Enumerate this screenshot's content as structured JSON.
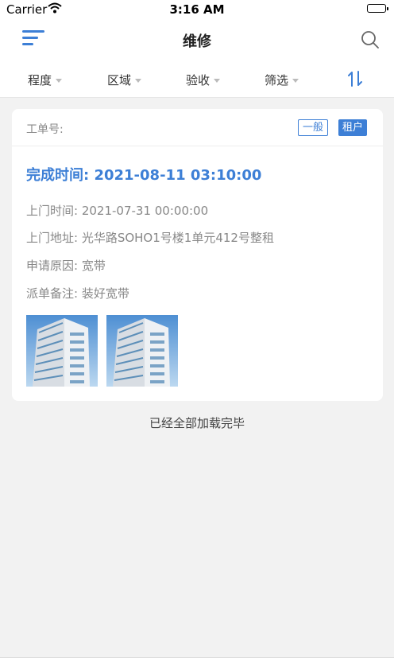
{
  "status_bar": {
    "carrier": "Carrier",
    "time": "3:16 AM"
  },
  "nav": {
    "title": "维修",
    "menu_icon": "menu-icon",
    "search_icon": "search-icon"
  },
  "filters": [
    {
      "label": "程度"
    },
    {
      "label": "区域"
    },
    {
      "label": "验收"
    },
    {
      "label": "筛选"
    }
  ],
  "sort_icon": "sort-icon",
  "card": {
    "order_label": "工单号:",
    "level_tag": "一般",
    "type_tag": "租户",
    "complete_time": "完成时间: 2021-08-11 03:10:00",
    "visit_time": "上门时间: 2021-07-31 00:00:00",
    "address": "上门地址: 光华路SOHO1号楼1单元412号整租",
    "reason": "申请原因: 宽带",
    "remark": "派单备注: 装好宽带",
    "photos": [
      "building-photo",
      "building-photo"
    ]
  },
  "footer_text": "已经全部加载完毕",
  "colors": {
    "accent": "#3d7fd6",
    "background": "#f2f2f2"
  }
}
